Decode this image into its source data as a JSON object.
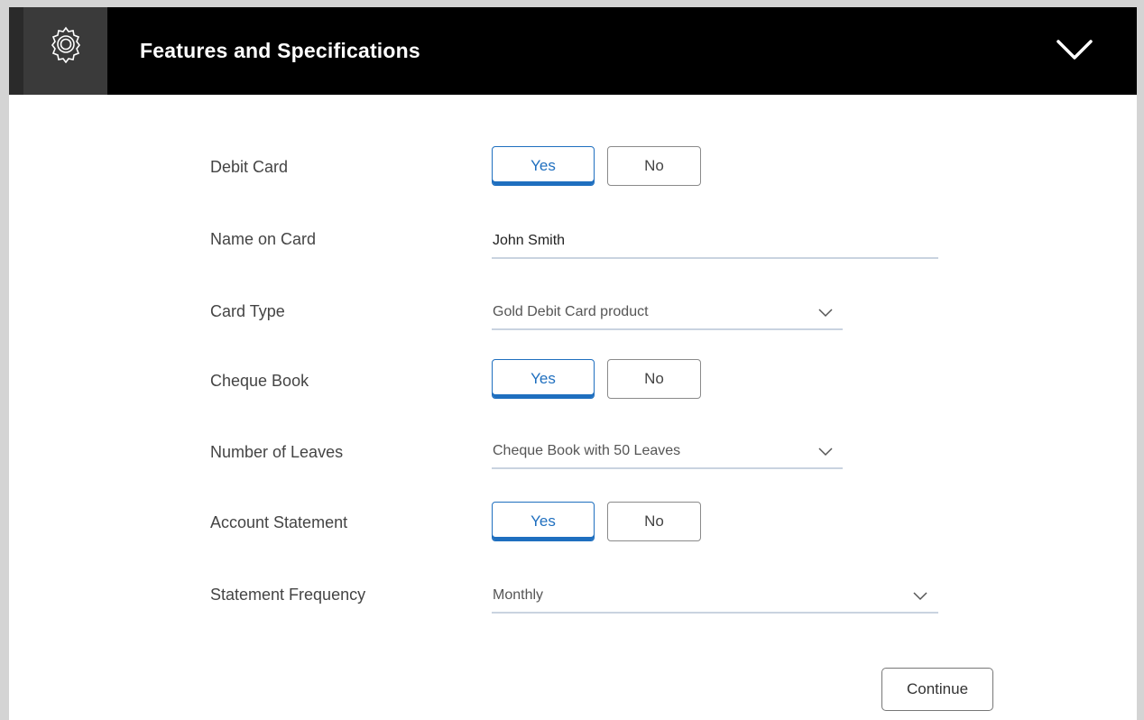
{
  "header": {
    "title": "Features and Specifications",
    "gear_icon": "gear-icon",
    "collapse_icon": "chevron-down-icon"
  },
  "form": {
    "debit_card": {
      "label": "Debit Card",
      "yes": "Yes",
      "no": "No",
      "selected": "Yes"
    },
    "name_on_card": {
      "label": "Name on Card",
      "value": "John Smith"
    },
    "card_type": {
      "label": "Card Type",
      "value": "Gold Debit Card product"
    },
    "cheque_book": {
      "label": "Cheque Book",
      "yes": "Yes",
      "no": "No",
      "selected": "Yes"
    },
    "number_of_leaves": {
      "label": "Number of Leaves",
      "value": "Cheque Book with 50 Leaves"
    },
    "account_statement": {
      "label": "Account Statement",
      "yes": "Yes",
      "no": "No",
      "selected": "Yes"
    },
    "statement_frequency": {
      "label": "Statement Frequency",
      "value": "Monthly"
    }
  },
  "actions": {
    "continue_label": "Continue"
  },
  "colors": {
    "accent": "#1f6fbf",
    "header_bg": "#000000",
    "underline": "#c9d3e0"
  }
}
